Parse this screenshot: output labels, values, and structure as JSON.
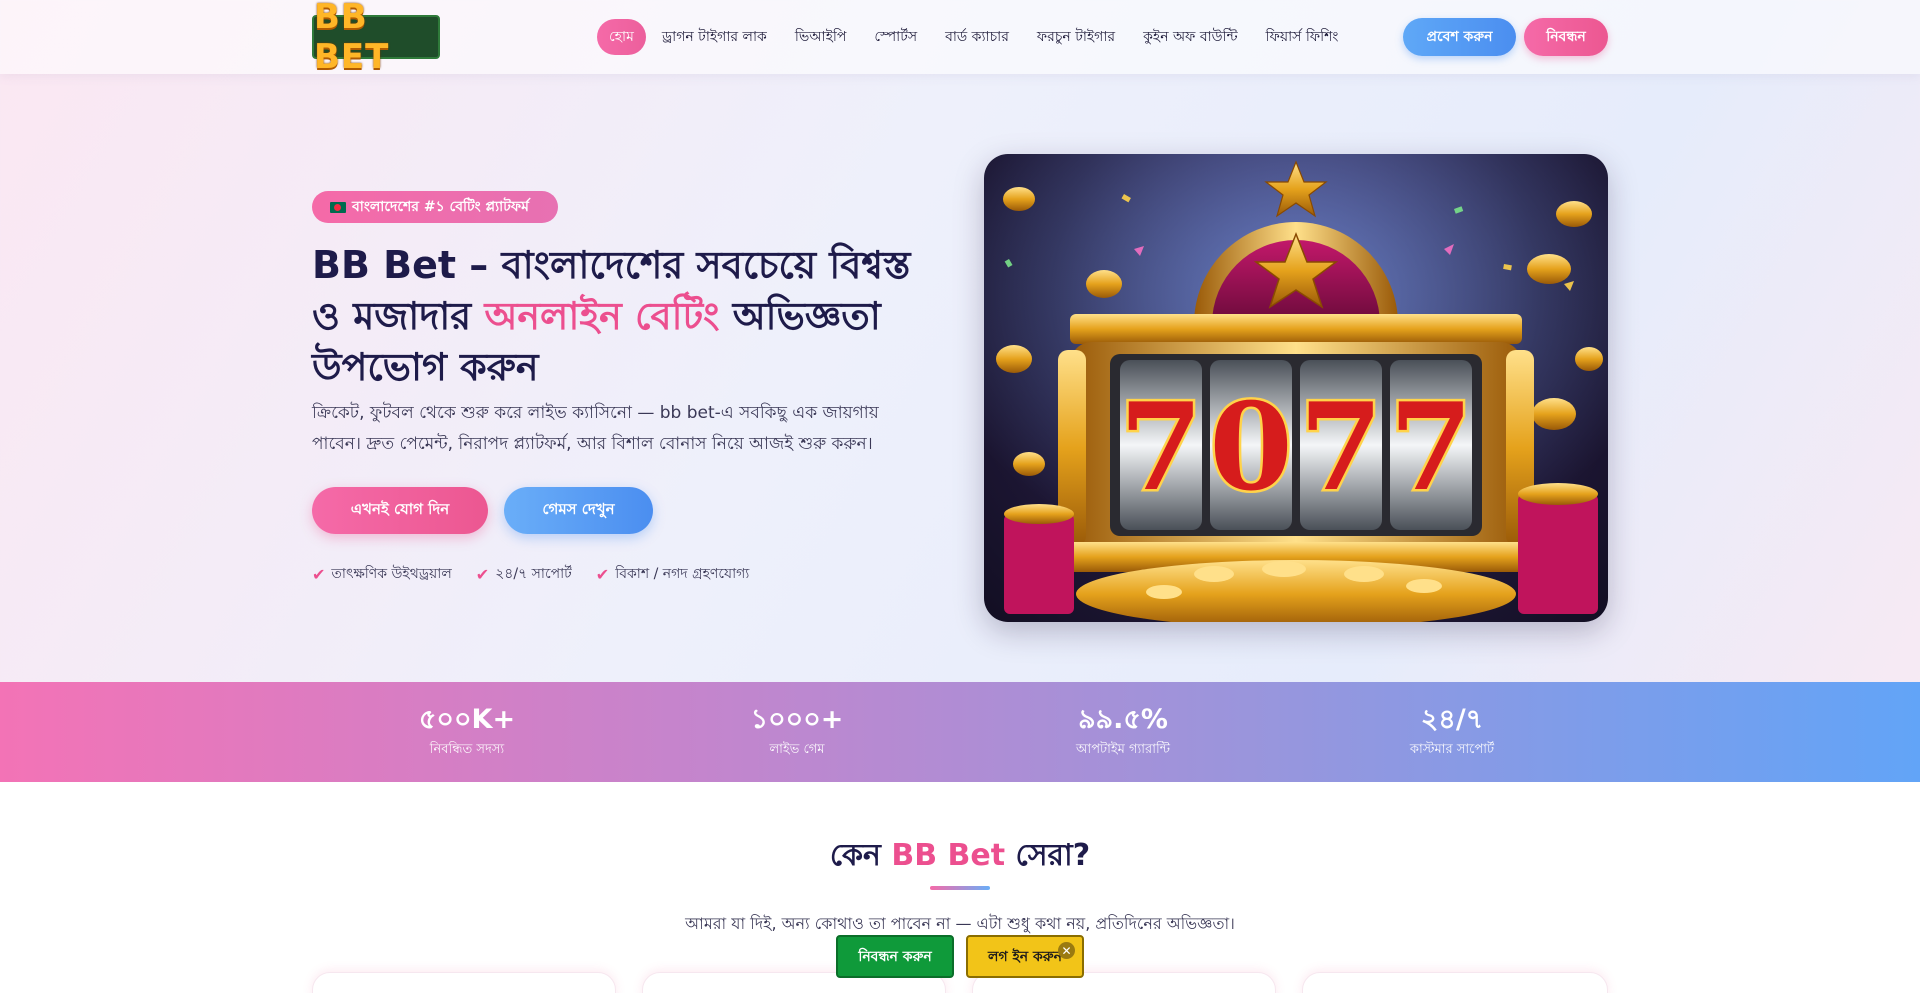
{
  "brand": {
    "logo_text": "BB BET"
  },
  "nav": {
    "items": [
      {
        "label": "হোম",
        "active": true
      },
      {
        "label": "ড্রাগন টাইগার লাক"
      },
      {
        "label": "ভিআইপি"
      },
      {
        "label": "স্পোর্টস"
      },
      {
        "label": "বার্ড ক্যাচার"
      },
      {
        "label": "ফরচুন টাইগার"
      },
      {
        "label": "কুইন অফ বাউন্টি"
      },
      {
        "label": "ফিয়ার্স ফিশিং"
      }
    ],
    "login_label": "প্রবেশ করুন",
    "register_label": "নিবন্ধন"
  },
  "hero": {
    "badge": "বাংলাদেশের #১ বেটিং প্ল্যাটফর্ম",
    "title_part1": "BB Bet – বাংলাদেশের সবচেয়ে বিশ্বস্ত ও মজাদার ",
    "title_highlight": "অনলাইন বেটিং",
    "title_part2": " অভিজ্ঞতা উপভোগ করুন",
    "description": "ক্রিকেট, ফুটবল থেকে শুরু করে লাইভ ক্যাসিনো — bb bet-এ সবকিছু এক জায়গায় পাবেন। দ্রুত পেমেন্ট, নিরাপদ প্ল্যাটফর্ম, আর বিশাল বোনাস নিয়ে আজই শুরু করুন।",
    "primary_cta": "এখনই যোগ দিন",
    "secondary_cta": "গেমস দেখুন",
    "features": [
      "তাৎক্ষণিক উইথড্রয়াল",
      "২৪/৭ সাপোর্ট",
      "বিকাশ / নগদ গ্রহণযোগ্য"
    ],
    "image_label": "7077"
  },
  "stats": [
    {
      "value": "৫০০K+",
      "label": "নিবন্ধিত সদস্য"
    },
    {
      "value": "১০০০+",
      "label": "লাইভ গেম"
    },
    {
      "value": "৯৯.৫%",
      "label": "আপটাইম গ্যারান্টি"
    },
    {
      "value": "২৪/৭",
      "label": "কাস্টমার সাপোর্ট"
    }
  ],
  "why": {
    "title_prefix": "কেন ",
    "title_highlight": "BB Bet",
    "title_suffix": " সেরা?",
    "subtitle": "আমরা যা দিই, অন্য কোথাও তা পাবেন না — এটা শুধু কথা নয়, প্রতিদিনের অভিজ্ঞতা।"
  },
  "floating": {
    "register_label": "নিবন্ধন করুন",
    "login_label": "লগ ইন করুন",
    "close_icon": "close-icon"
  },
  "colors": {
    "accent_pink": "#ec4f8f",
    "accent_blue": "#4b8ef0",
    "float_green": "#0f9a3a",
    "float_yellow": "#f2c418"
  }
}
